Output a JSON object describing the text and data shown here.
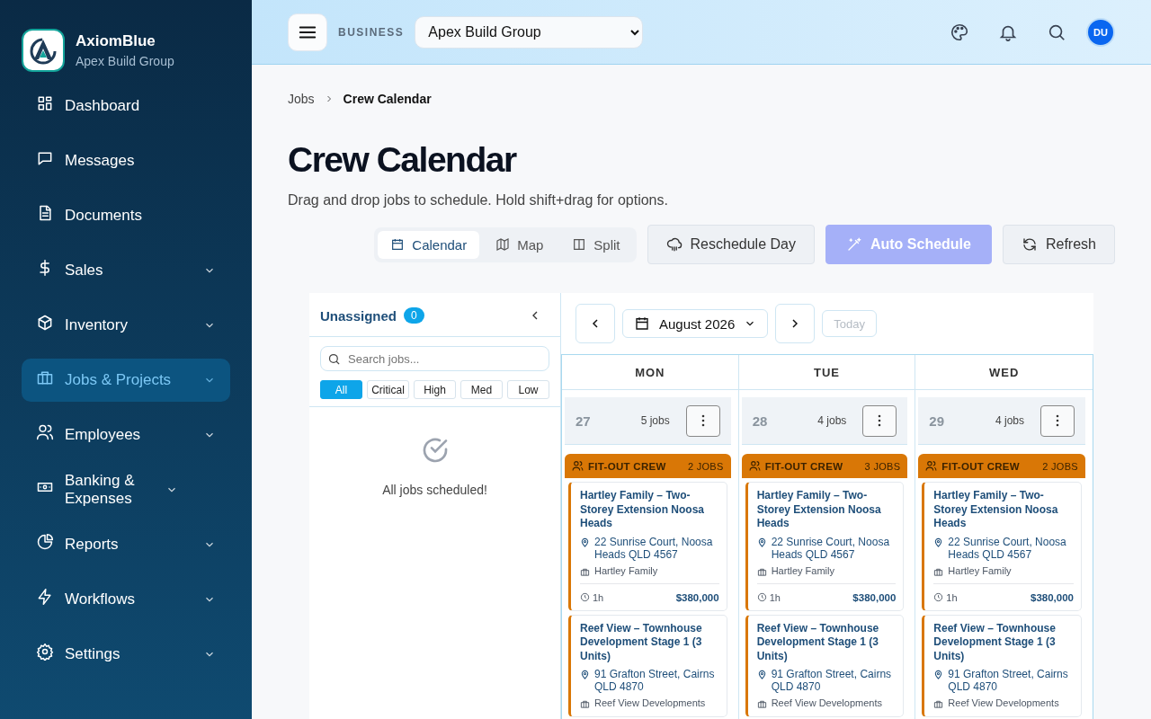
{
  "brand": {
    "name": "AxiomBlue",
    "org": "Apex Build Group"
  },
  "nav": [
    {
      "label": "Dashboard",
      "expandable": false,
      "selected": false
    },
    {
      "label": "Messages",
      "expandable": false,
      "selected": false
    },
    {
      "label": "Documents",
      "expandable": false,
      "selected": false
    },
    {
      "label": "Sales",
      "expandable": true,
      "selected": false
    },
    {
      "label": "Inventory",
      "expandable": true,
      "selected": false
    },
    {
      "label": "Jobs & Projects",
      "expandable": true,
      "selected": true
    },
    {
      "label": "Employees",
      "expandable": true,
      "selected": false
    },
    {
      "label": "Banking & Expenses",
      "expandable": true,
      "selected": false
    },
    {
      "label": "Reports",
      "expandable": true,
      "selected": false
    },
    {
      "label": "Workflows",
      "expandable": true,
      "selected": false
    },
    {
      "label": "Settings",
      "expandable": true,
      "selected": false
    }
  ],
  "header": {
    "business_label": "BUSINESS",
    "business_select": "Apex Build Group",
    "avatar": "DU"
  },
  "breadcrumb": [
    "Jobs",
    "Crew Calendar"
  ],
  "title": "Crew Calendar",
  "subtitle": "Drag and drop jobs to schedule. Hold shift+drag for options.",
  "view_tabs": [
    {
      "label": "Calendar",
      "selected": true
    },
    {
      "label": "Map",
      "selected": false
    },
    {
      "label": "Split",
      "selected": false
    }
  ],
  "actions": [
    {
      "label": "Reschedule Day",
      "kind": "secondary",
      "disabled": false
    },
    {
      "label": "Auto Schedule",
      "kind": "primary",
      "disabled": true
    },
    {
      "label": "Refresh",
      "kind": "secondary",
      "disabled": false
    }
  ],
  "unassigned": {
    "title": "Unassigned",
    "count": "0",
    "search_placeholder": "Search jobs...",
    "filters": [
      {
        "label": "All",
        "selected": true
      },
      {
        "label": "Critical",
        "selected": false
      },
      {
        "label": "High",
        "selected": false
      },
      {
        "label": "Med",
        "selected": false
      },
      {
        "label": "Low",
        "selected": false
      }
    ],
    "empty_message": "All jobs scheduled!"
  },
  "calendar": {
    "month": "August 2026",
    "today": {
      "label": "Today",
      "disabled": true
    },
    "days": [
      {
        "weekday": "MON",
        "date": "27",
        "count": "5 jobs",
        "crews": [
          {
            "name": "FIT-OUT CREW",
            "count": "2 JOBS",
            "color": "#d97706",
            "jobs": [
              {
                "title": "Hartley Family – Two-Storey Extension Noosa Heads",
                "address": "22 Sunrise Court, Noosa Heads QLD 4567",
                "client": "Hartley Family",
                "duration": "1h",
                "value": "$380,000"
              },
              {
                "title": "Reef View – Townhouse Development Stage 1 (3 Units)",
                "address": "91 Grafton Street, Cairns QLD 4870",
                "client": "Reef View Developments"
              }
            ]
          }
        ]
      },
      {
        "weekday": "TUE",
        "date": "28",
        "count": "4 jobs",
        "crews": [
          {
            "name": "FIT-OUT CREW",
            "count": "3 JOBS",
            "color": "#d97706",
            "jobs": [
              {
                "title": "Hartley Family – Two-Storey Extension Noosa Heads",
                "address": "22 Sunrise Court, Noosa Heads QLD 4567",
                "client": "Hartley Family",
                "duration": "1h",
                "value": "$380,000"
              },
              {
                "title": "Reef View – Townhouse Development Stage 1 (3 Units)",
                "address": "91 Grafton Street, Cairns QLD 4870",
                "client": "Reef View Developments"
              }
            ]
          }
        ]
      },
      {
        "weekday": "WED",
        "date": "29",
        "count": "4 jobs",
        "crews": [
          {
            "name": "FIT-OUT CREW",
            "count": "2 JOBS",
            "color": "#d97706",
            "jobs": [
              {
                "title": "Hartley Family – Two-Storey Extension Noosa Heads",
                "address": "22 Sunrise Court, Noosa Heads QLD 4567",
                "client": "Hartley Family",
                "duration": "1h",
                "value": "$380,000"
              },
              {
                "title": "Reef View – Townhouse Development Stage 1 (3 Units)",
                "address": "91 Grafton Street, Cairns QLD 4870",
                "client": "Reef View Developments"
              }
            ]
          }
        ]
      }
    ]
  }
}
